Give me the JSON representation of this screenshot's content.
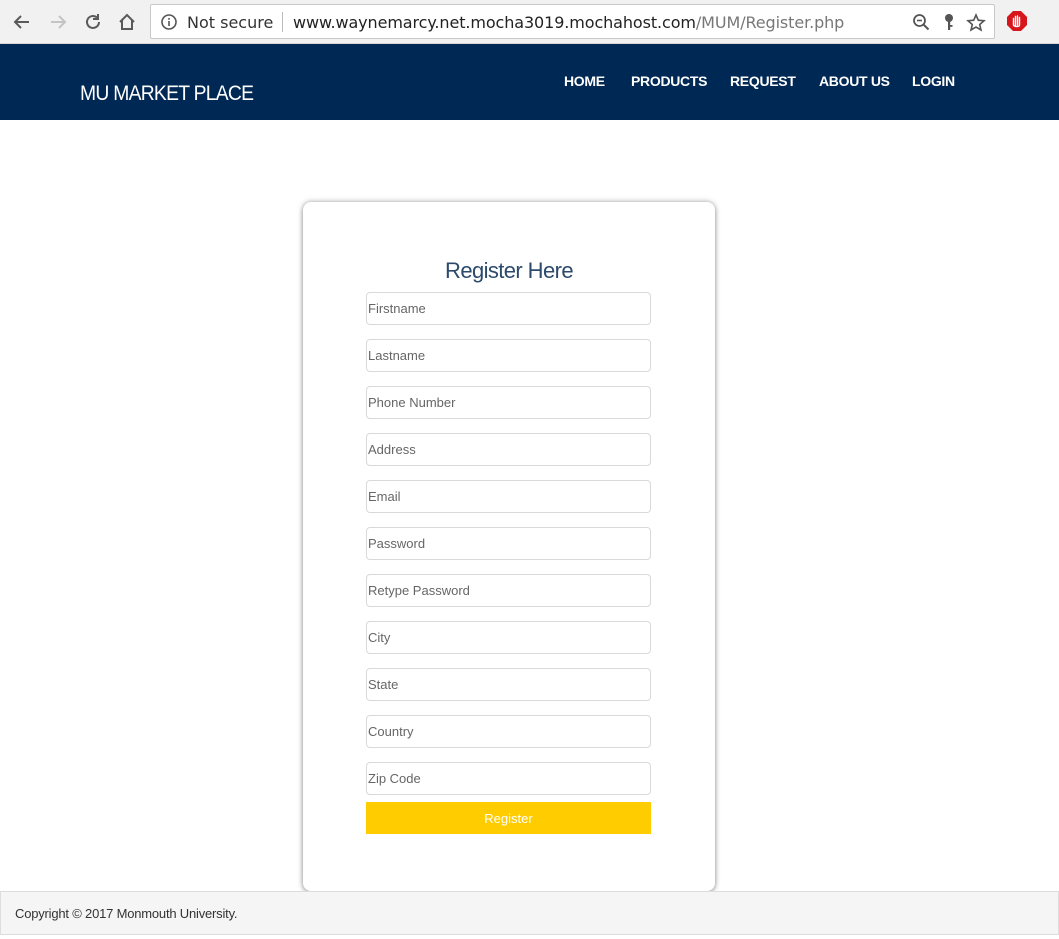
{
  "browser": {
    "security_label": "Not secure",
    "url_host": "www.waynemarcy.net.mocha3019.mochahost.com",
    "url_path": "/MUM/Register.php"
  },
  "header": {
    "brand": "MU MARKET PLACE",
    "nav": [
      "HOME",
      "PRODUCTS",
      "REQUEST",
      "ABOUT US",
      "LOGIN"
    ]
  },
  "form": {
    "title": "Register Here",
    "fields": [
      {
        "placeholder": "Firstname",
        "value": ""
      },
      {
        "placeholder": "Lastname",
        "value": ""
      },
      {
        "placeholder": "Phone Number",
        "value": ""
      },
      {
        "placeholder": "Address",
        "value": ""
      },
      {
        "placeholder": "Email",
        "value": ""
      },
      {
        "placeholder": "Password",
        "value": ""
      },
      {
        "placeholder": "Retype Password",
        "value": ""
      },
      {
        "placeholder": "City",
        "value": ""
      },
      {
        "placeholder": "State",
        "value": ""
      },
      {
        "placeholder": "Country",
        "value": ""
      },
      {
        "placeholder": "Zip Code",
        "value": ""
      }
    ],
    "submit_label": "Register"
  },
  "footer": {
    "copyright": "Copyright © 2017 Monmouth University."
  },
  "icons": {
    "back": "arrow-left-icon",
    "forward": "arrow-right-icon",
    "reload": "reload-icon",
    "home": "home-icon",
    "info": "info-icon",
    "zoom": "zoom-out-icon",
    "key": "key-icon",
    "bookmark": "star-icon",
    "extension": "stop-hand-icon"
  },
  "colors": {
    "header_bg": "#002855",
    "accent_button": "#ffcc00",
    "title_text": "#2c4a6c"
  }
}
